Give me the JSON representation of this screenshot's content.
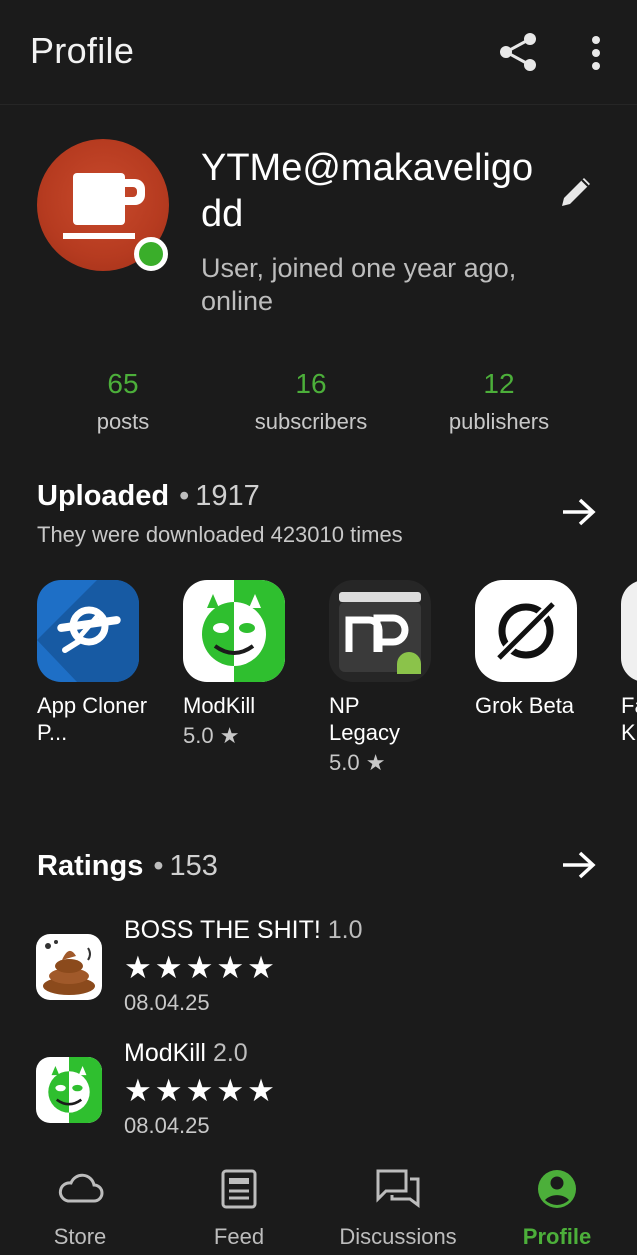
{
  "topbar": {
    "title": "Profile"
  },
  "profile": {
    "username": "YTMe@makaveligodd",
    "status": "User, joined one year ago, online"
  },
  "stats": [
    {
      "value": "65",
      "label": "posts"
    },
    {
      "value": "16",
      "label": "subscribers"
    },
    {
      "value": "12",
      "label": "publishers"
    }
  ],
  "uploaded": {
    "title": "Uploaded",
    "count": "1917",
    "subtitle": "They were downloaded 423010 times",
    "apps": [
      {
        "name": "App Cloner P...",
        "rating": ""
      },
      {
        "name": "ModKill",
        "rating": "5.0 ★"
      },
      {
        "name": "NP Legacy",
        "rating": "5.0 ★"
      },
      {
        "name": "Grok Beta",
        "rating": ""
      },
      {
        "name": "Fa K",
        "rating": ""
      }
    ]
  },
  "ratings": {
    "title": "Ratings",
    "count": "153",
    "items": [
      {
        "name": "BOSS THE SHIT!",
        "version": "1.0",
        "stars": "★★★★★",
        "date": "08.04.25"
      },
      {
        "name": "ModKill",
        "version": "2.0",
        "stars": "★★★★★",
        "date": "08.04.25"
      }
    ]
  },
  "nav": [
    {
      "label": "Store"
    },
    {
      "label": "Feed"
    },
    {
      "label": "Discussions"
    },
    {
      "label": "Profile"
    }
  ],
  "colors": {
    "accent": "#4caf3a",
    "background": "#1b1b1b"
  }
}
